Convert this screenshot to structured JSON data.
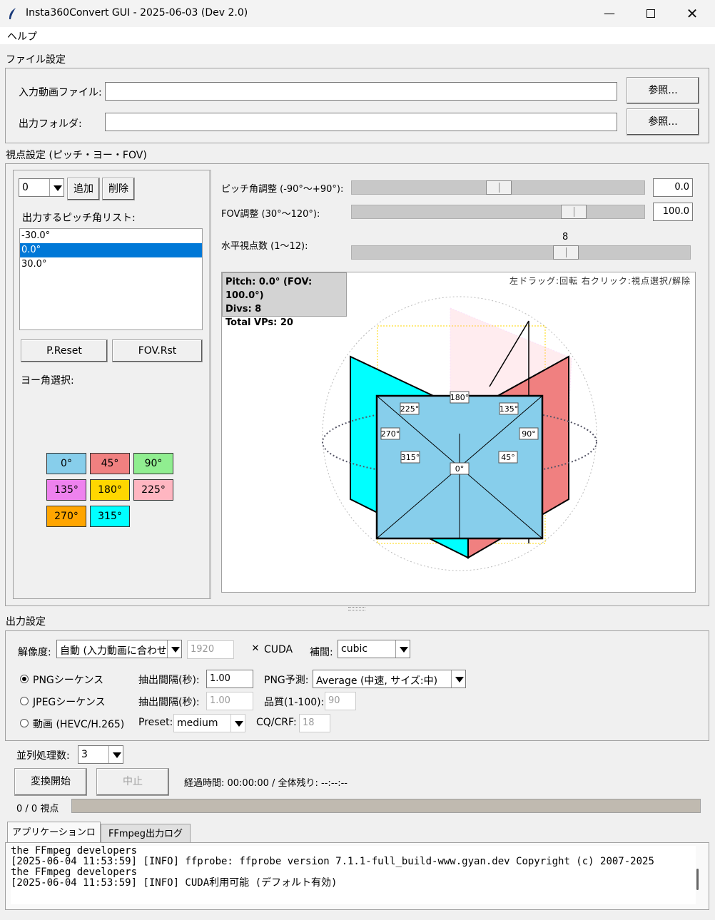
{
  "window": {
    "title": "Insta360Convert GUI - 2025-06-03 (Dev 2.0)"
  },
  "menu": {
    "help": "ヘルプ"
  },
  "file_settings": {
    "section_title": "ファイル設定",
    "input_label": "入力動画ファイル:",
    "input_value": "",
    "output_label": "出力フォルダ:",
    "output_value": "",
    "browse_label": "参照..."
  },
  "viewpoint": {
    "section_title": "視点設定 (ピッチ・ヨー・FOV)",
    "pitch_combo_value": "0",
    "add_label": "追加",
    "delete_label": "削除",
    "pitch_list_label": "出力するピッチ角リスト:",
    "pitch_list": [
      "-30.0°",
      "0.0°",
      "30.0°"
    ],
    "pitch_list_selected_index": 1,
    "p_reset_label": "P.Reset",
    "fov_reset_label": "FOV.Rst",
    "yaw_label": "ヨー角選択:",
    "yaw_buttons": [
      {
        "label": "0°",
        "color": "#87ceeb"
      },
      {
        "label": "45°",
        "color": "#f08080"
      },
      {
        "label": "90°",
        "color": "#90ee90"
      },
      {
        "label": "135°",
        "color": "#ee82ee"
      },
      {
        "label": "180°",
        "color": "#ffd700"
      },
      {
        "label": "225°",
        "color": "#ffb6c1"
      },
      {
        "label": "270°",
        "color": "#ffa500"
      },
      {
        "label": "315°",
        "color": "#00ffff"
      }
    ],
    "pitch_slider_label": "ピッチ角調整 (-90°〜+90°):",
    "pitch_value": "0.0",
    "pitch_fraction": 0.5,
    "fov_slider_label": "FOV調整 (30°〜120°):",
    "fov_value": "100.0",
    "fov_fraction": 0.78,
    "hdiv_label": "水平視点数 (1〜12):",
    "hdiv_value": "8",
    "hdiv_fraction": 0.64
  },
  "preview": {
    "info_line1": "Pitch: 0.0° (FOV: 100.0°)",
    "info_line2": "Divs: 8",
    "info_line3": "Total VPs: 20",
    "hint": "左ドラッグ:回転  右クリック:視点選択/解除",
    "yaw_labels": [
      "180°",
      "225°",
      "135°",
      "270°",
      "90°",
      "315°",
      "45°",
      "0°"
    ],
    "colors": {
      "front": "#87ceeb",
      "right": "#f08080",
      "left": "#00ffff"
    }
  },
  "output": {
    "section_title": "出力設定",
    "resolution_label": "解像度:",
    "resolution_value": "自動 (入力動画に合わせる)",
    "resolution_custom": "1920",
    "cuda_label": "CUDA",
    "cuda_checked": true,
    "interp_label": "補間:",
    "interp_value": "cubic",
    "png_label": "PNGシーケンス",
    "jpeg_label": "JPEGシーケンス",
    "video_label": "動画 (HEVC/H.265)",
    "interval_label": "抽出間隔(秒):",
    "png_interval": "1.00",
    "jpeg_interval": "1.00",
    "png_pred_label": "PNG予測:",
    "png_pred_value": "Average (中速, サイズ:中)",
    "quality_label": "品質(1-100):",
    "quality_value": "90",
    "preset_label": "Preset:",
    "preset_value": "medium",
    "crf_label": "CQ/CRF:",
    "crf_value": "18",
    "selected_format": "png"
  },
  "process": {
    "parallel_label": "並列処理数:",
    "parallel_value": "3",
    "start_label": "変換開始",
    "stop_label": "中止",
    "elapsed": "経過時間: 00:00:00 / 全体残り: --:--:--",
    "progress_text": "0 / 0 視点",
    "progress_fraction": 0
  },
  "log": {
    "tab_app": "アプリケーションログ",
    "tab_ffmpeg": "FFmpeg出力ログ",
    "lines": [
      "the FFmpeg developers",
      "[2025-06-04 11:53:59] [INFO] ffprobe: ffprobe version 7.1.1-full_build-www.gyan.dev Copyright (c) 2007-2025",
      "the FFmpeg developers",
      "[2025-06-04 11:53:59] [INFO] CUDA利用可能 (デフォルト有効)"
    ]
  }
}
